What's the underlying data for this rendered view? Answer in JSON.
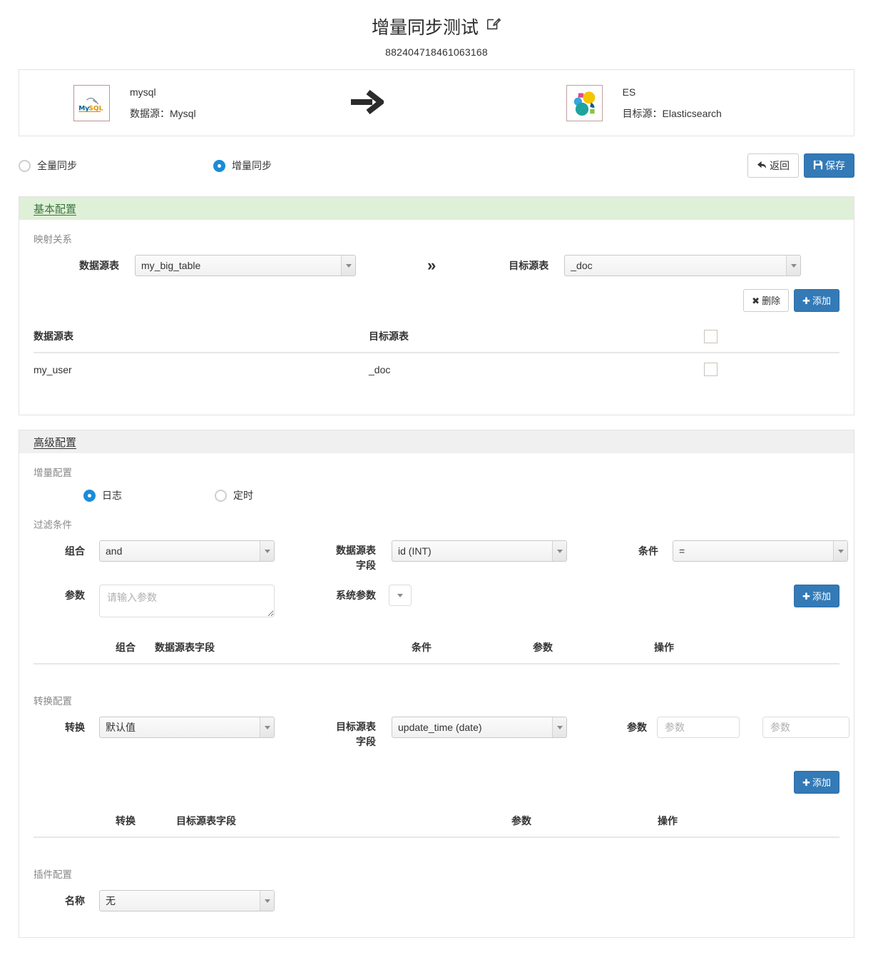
{
  "header": {
    "title": "增量同步测试",
    "edit_icon": "edit-pencil-icon",
    "job_id": "882404718461063168"
  },
  "endpoints": {
    "source": {
      "logo": "mysql-logo",
      "name": "mysql",
      "sub": "数据源：Mysql"
    },
    "arrow_icon": "arrow-right-icon",
    "target": {
      "logo": "elasticsearch-logo",
      "name": "ES",
      "sub": "目标源：Elasticsearch"
    }
  },
  "sync_mode": {
    "options": [
      {
        "label": "全量同步",
        "checked": false
      },
      {
        "label": "增量同步",
        "checked": true
      }
    ],
    "back_button": "返回",
    "back_icon": "back-arrow-icon",
    "save_button": "保存",
    "save_icon": "floppy-save-icon"
  },
  "basic_config": {
    "heading": "基本配置",
    "mapping_label": "映射关系",
    "source_table_label": "数据源表",
    "source_table_value": "my_big_table",
    "arrow_icon": "double-chevron-right-icon",
    "target_table_label": "目标源表",
    "target_table_value": "_doc",
    "delete_button": "删除",
    "delete_icon": "times-icon",
    "add_button": "添加",
    "add_icon": "plus-icon",
    "table": {
      "columns": [
        "数据源表",
        "目标源表",
        ""
      ],
      "rows": [
        {
          "source": "my_user",
          "target": "_doc",
          "checked": false
        }
      ]
    }
  },
  "advanced_config": {
    "heading": "高级配置",
    "incremental": {
      "label": "增量配置",
      "options": [
        {
          "label": "日志",
          "checked": true
        },
        {
          "label": "定时",
          "checked": false
        }
      ]
    },
    "filter": {
      "label": "过滤条件",
      "combine_label": "组合",
      "combine_value": "and",
      "field_label": "数据源表\n字段",
      "field_label_line1": "数据源表",
      "field_label_line2": "字段",
      "field_value": "id (INT)",
      "condition_label": "条件",
      "condition_value": "=",
      "param_label": "参数",
      "param_value": "",
      "param_placeholder": "请输入参数",
      "sys_param_label": "系统参数",
      "sys_param_icon": "chevron-down-icon",
      "add_button": "添加",
      "add_icon": "plus-icon",
      "table": {
        "columns": [
          "组合",
          "数据源表字段",
          "条件",
          "参数",
          "操作"
        ],
        "rows": []
      }
    },
    "transform": {
      "label": "转换配置",
      "transform_label": "转换",
      "transform_value": "默认值",
      "field_label_line1": "目标源表",
      "field_label_line2": "字段",
      "field_value": "update_time (date)",
      "param_label": "参数",
      "param1_value": "",
      "param1_placeholder": "参数",
      "param2_value": "",
      "param2_placeholder": "参数",
      "add_button": "添加",
      "add_icon": "plus-icon",
      "table": {
        "columns": [
          "转换",
          "目标源表字段",
          "参数",
          "操作"
        ],
        "rows": []
      }
    },
    "plugin": {
      "label": "插件配置",
      "name_label": "名称",
      "name_value": "无"
    }
  },
  "colors": {
    "primary": "#337ab7",
    "radio_active": "#1a8cd8",
    "basic_header_bg": "#dff0d8",
    "basic_header_text": "#3c763d",
    "advanced_header_bg": "#f0f0f0"
  }
}
